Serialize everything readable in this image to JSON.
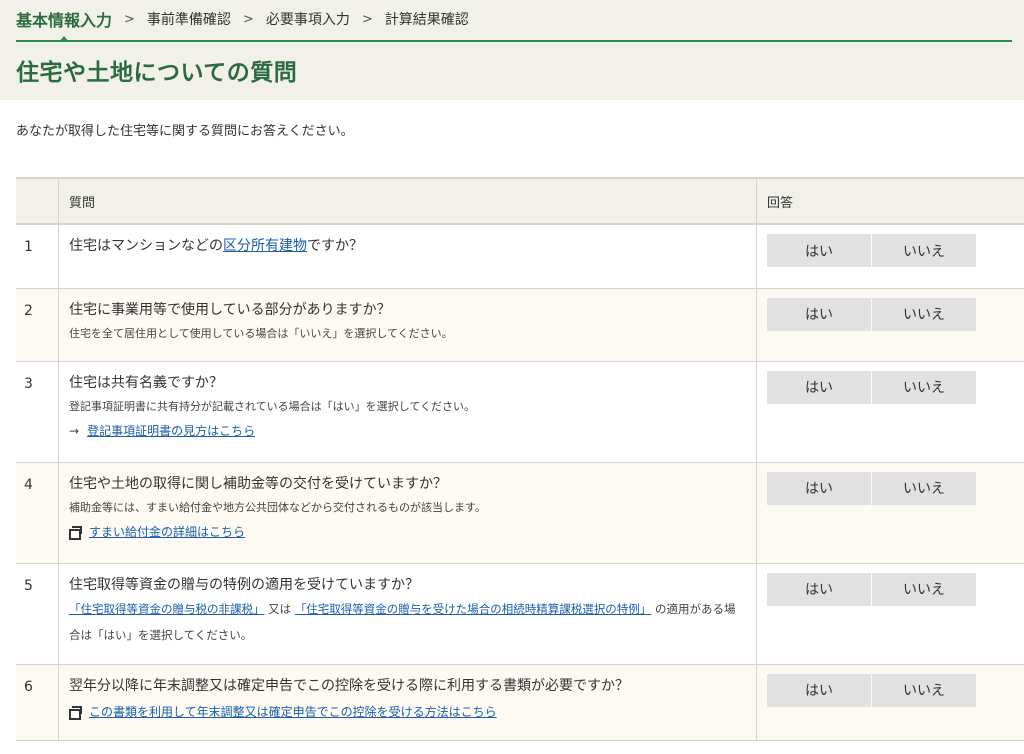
{
  "breadcrumb": {
    "steps": [
      "基本情報入力",
      "事前準備確認",
      "必要事項入力",
      "計算結果確認"
    ]
  },
  "page_title": "住宅や土地についての質問",
  "intro": "あなたが取得した住宅等に関する質問にお答えください。",
  "table": {
    "headers": {
      "question": "質問",
      "answer": "回答"
    },
    "yes_label": "はい",
    "no_label": "いいえ",
    "rows": [
      {
        "num": "1",
        "q_pre": "住宅はマンションなどの",
        "q_link": "区分所有建物",
        "q_post": "ですか？"
      },
      {
        "num": "2",
        "question": "住宅に事業用等で使用している部分がありますか？",
        "note": "住宅を全て居住用として使用している場合は「いいえ」を選択してください。"
      },
      {
        "num": "3",
        "question": "住宅は共有名義ですか？",
        "note": "登記事項証明書に共有持分が記載されている場合は「はい」を選択してください。",
        "link_arrow": "→",
        "link": "登記事項証明書の見方はこちら"
      },
      {
        "num": "4",
        "question": "住宅や土地の取得に関し補助金等の交付を受けていますか？",
        "note": "補助金等には、すまい給付金や地方公共団体などから交付されるものが該当します。",
        "link": "すまい給付金の詳細はこちら"
      },
      {
        "num": "5",
        "question": "住宅取得等資金の贈与の特例の適用を受けていますか？",
        "link_a": "「住宅取得等資金の贈与税の非課税」",
        "mid": " 又は ",
        "link_b": "「住宅取得等資金の贈与を受けた場合の相続時精算課税選択の特例」",
        "tail": " の適用がある場合は「はい」を選択してください。"
      },
      {
        "num": "6",
        "question": "翌年分以降に年末調整又は確定申告でこの控除を受ける際に利用する書類が必要ですか？",
        "link": "この書類を利用して年末調整又は確定申告でこの控除を受ける方法はこちら"
      }
    ]
  },
  "colors": {
    "accent_green": "#2b6b3f",
    "rule_green": "#2b8a4a",
    "header_bg": "#f2f1e9",
    "link_blue": "#1a5fa8",
    "button_bg": "#e1e1e1"
  },
  "icons": [
    "chevron-right-icon",
    "arrow-right-icon",
    "external-window-icon"
  ]
}
